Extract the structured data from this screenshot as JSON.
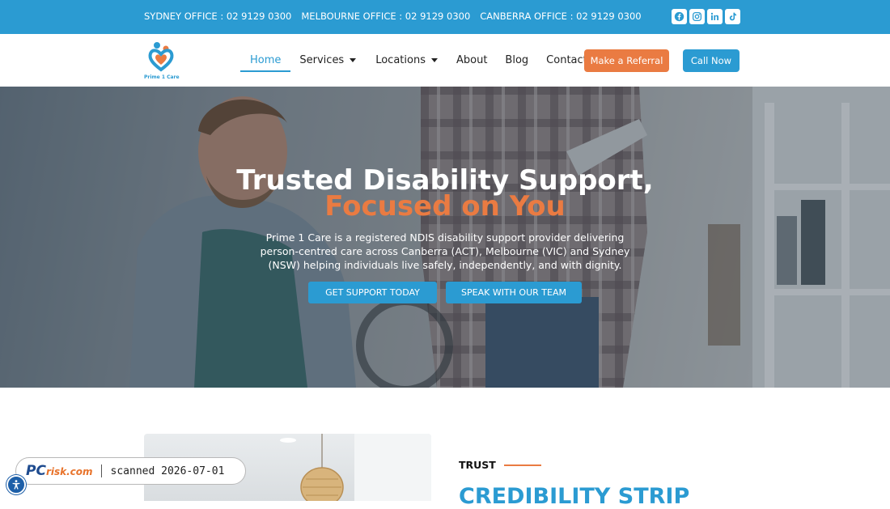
{
  "topbar": {
    "offices": [
      "SYDNEY OFFICE : 02 9129 0300",
      "MELBOURNE OFFICE : 02 9129 0300",
      "CANBERRA OFFICE : 02 9129 0300"
    ],
    "socials": [
      "facebook-icon",
      "instagram-icon",
      "linkedin-icon",
      "tiktok-icon"
    ]
  },
  "header": {
    "logo_text": "Prime 1 Care",
    "nav": [
      {
        "label": "Home",
        "active": true,
        "dropdown": false
      },
      {
        "label": "Services",
        "active": false,
        "dropdown": true
      },
      {
        "label": "Locations",
        "active": false,
        "dropdown": true
      },
      {
        "label": "About",
        "active": false,
        "dropdown": false
      },
      {
        "label": "Blog",
        "active": false,
        "dropdown": false
      },
      {
        "label": "Contact",
        "active": false,
        "dropdown": false
      }
    ],
    "referral_label": "Make a Referral",
    "call_label": "Call Now"
  },
  "hero": {
    "title": "Trusted Disability Support,",
    "title_highlight": "Focused on You",
    "description": "Prime 1 Care is a registered NDIS disability support provider delivering person-centred care across Canberra (ACT), Melbourne (VIC) and Sydney (NSW) helping individuals live safely, independently, and with dignity.",
    "primary_button": "GET SUPPORT TODAY",
    "secondary_button": "SPEAK WITH OUR TEAM"
  },
  "section": {
    "eyebrow": "TRUST",
    "heading": "CREDIBILITY STRIP"
  },
  "watermark": {
    "brand_pc": "PC",
    "brand_risk": "risk.com",
    "scan_text": "scanned 2026-07-01"
  },
  "colors": {
    "primary_blue": "#2b9bd2",
    "accent_orange": "#ea7b42",
    "text_dark": "#222222"
  }
}
